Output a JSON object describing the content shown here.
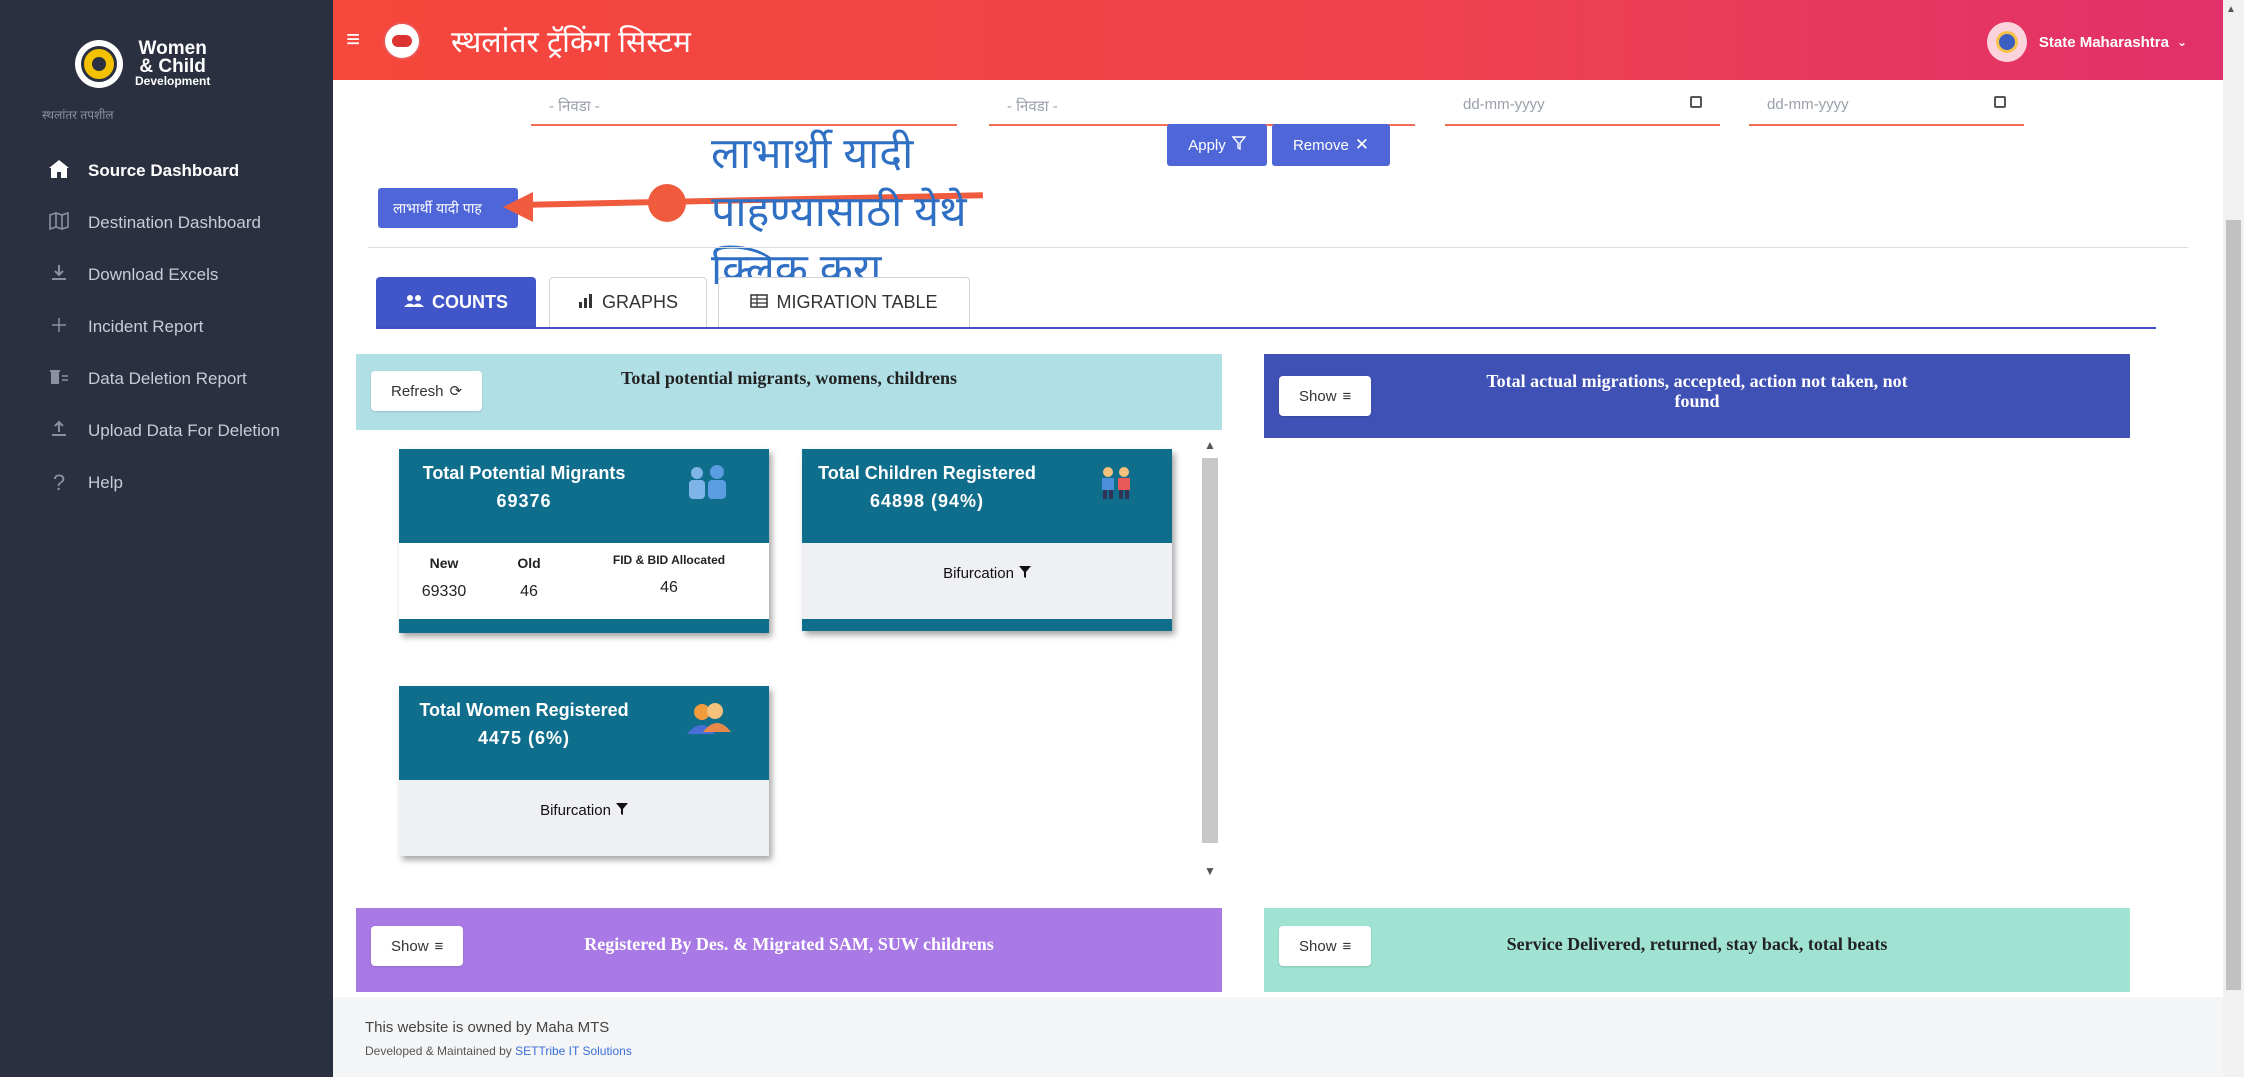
{
  "sidebar": {
    "logo": {
      "line1": "Women",
      "line2": "& Child",
      "line3": "Development"
    },
    "subtitle": "स्थलांतर तपशील",
    "items": [
      {
        "label": "Source Dashboard",
        "icon": "home-icon"
      },
      {
        "label": "Destination Dashboard",
        "icon": "map-icon"
      },
      {
        "label": "Download Excels",
        "icon": "download-icon"
      },
      {
        "label": "Incident Report",
        "icon": "plus-icon"
      },
      {
        "label": "Data Deletion Report",
        "icon": "trash-icon"
      },
      {
        "label": "Upload Data For Deletion",
        "icon": "upload-icon"
      },
      {
        "label": "Help",
        "icon": "question-icon"
      }
    ]
  },
  "header": {
    "title": "स्थलांतर ट्रॅकिंग सिस्टम",
    "profile": "State Maharashtra"
  },
  "filters": {
    "select1": "- निवडा -",
    "select2": "- निवडा -",
    "date1": "dd-mm-yyyy",
    "date2": "dd-mm-yyyy",
    "apply": "Apply",
    "remove": "Remove"
  },
  "beneficiary_button": "लाभार्थी यादी पाह",
  "annotation": {
    "line1": "लाभार्थी यादी",
    "line2": "पाहण्यासाठी येथे",
    "line3": "क्लिक करा"
  },
  "tabs": [
    {
      "label": "COUNTS",
      "icon": "users-icon"
    },
    {
      "label": "GRAPHS",
      "icon": "bar-chart-icon"
    },
    {
      "label": "MIGRATION TABLE",
      "icon": "table-icon"
    }
  ],
  "panels": {
    "potential": {
      "title": "Total potential migrants, womens, childrens",
      "button": "Refresh",
      "color": "#b0e0e6"
    },
    "actual": {
      "title": "Total actual migrations, accepted, action not taken, not found",
      "button": "Show",
      "color": "#3f51b5"
    },
    "registered": {
      "title": "Registered By Des. & Migrated SAM, SUW childrens",
      "button": "Show",
      "color": "#a97ae6"
    },
    "service": {
      "title": "Service Delivered, returned, stay back, total beats",
      "button": "Show",
      "color": "#a0e3d3"
    }
  },
  "cards": {
    "migrants": {
      "title": "Total Potential Migrants",
      "value": "69376",
      "new_label": "New",
      "new_value": "69330",
      "old_label": "Old",
      "old_value": "46",
      "fid_label": "FID & BID Allocated",
      "fid_value": "46"
    },
    "children": {
      "title": "Total Children Registered",
      "value": "64898 (94%)",
      "bifurcation": "Bifurcation"
    },
    "women": {
      "title": "Total Women Registered",
      "value": "4475 (6%)",
      "bifurcation": "Bifurcation"
    }
  },
  "footer": {
    "owned": "This website is owned by Maha MTS",
    "developed": "Developed & Maintained by",
    "company": "SETTribe IT Solutions"
  },
  "colors": {
    "accent": "#4f66d8",
    "card": "#0f6e8c",
    "sidebar": "#2b3040",
    "header_start": "#f5473b",
    "header_end": "#e12f6c"
  }
}
